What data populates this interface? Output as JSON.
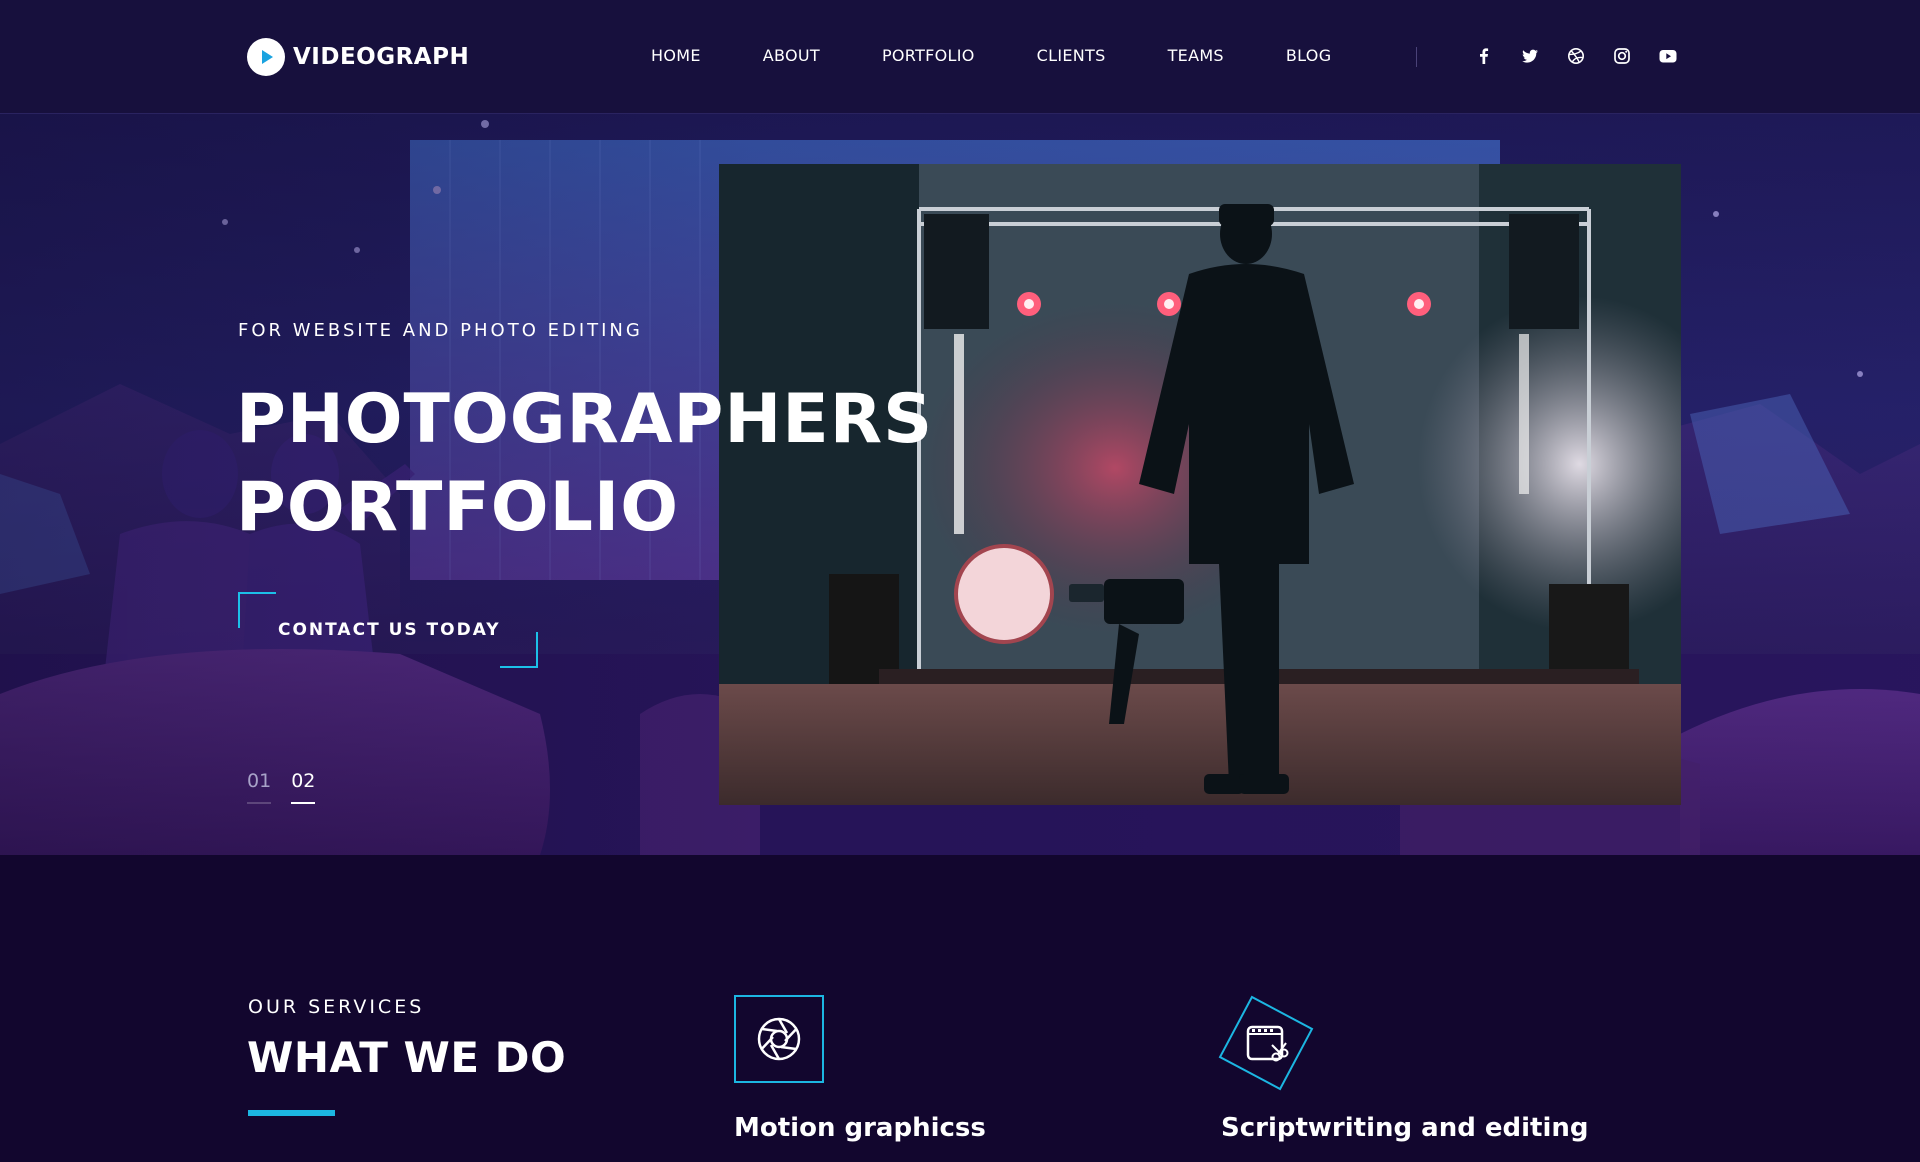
{
  "brand": {
    "name": "VIDEOGRAPH",
    "logo_icon": "play-icon",
    "accent": "#1cb6e2"
  },
  "nav": {
    "items": [
      {
        "label": "HOME"
      },
      {
        "label": "ABOUT"
      },
      {
        "label": "PORTFOLIO"
      },
      {
        "label": "CLIENTS"
      },
      {
        "label": "TEAMS"
      },
      {
        "label": "BLOG"
      }
    ]
  },
  "social": [
    "facebook-icon",
    "twitter-icon",
    "dribbble-icon",
    "instagram-icon",
    "youtube-icon"
  ],
  "hero": {
    "kicker": "FOR WEBSITE AND PHOTO EDITING",
    "title_line1": "PHOTOGRAPHERS",
    "title_line2": "PORTFOLIO",
    "cta_label": "CONTACT US TODAY",
    "slides": [
      {
        "label": "01",
        "active": false
      },
      {
        "label": "02",
        "active": true
      }
    ]
  },
  "services": {
    "kicker": "OUR SERVICES",
    "title": "WHAT WE DO",
    "items": [
      {
        "name": "Motion graphicss",
        "icon": "aperture-icon"
      },
      {
        "name": "Scriptwriting and editing",
        "icon": "film-scissors-icon"
      }
    ]
  }
}
